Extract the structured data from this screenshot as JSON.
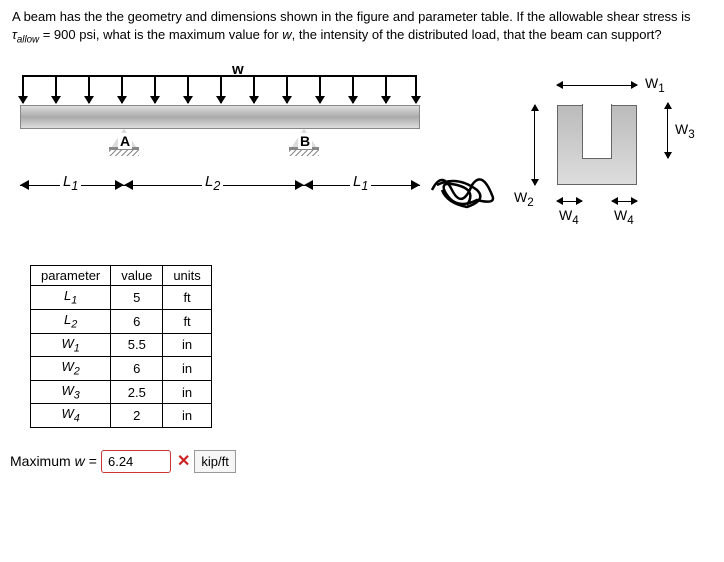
{
  "problem": {
    "text_before_tau": "A beam has the the geometry and dimensions shown in the figure and parameter table. If the allowable shear stress is ",
    "tau_symbol": "τ",
    "tau_sub": "allow",
    "tau_value": " = 900 psi, what is the maximum value for ",
    "w_var": "w",
    "text_after_w": ", the intensity of the distributed load, that the beam can support?"
  },
  "figure": {
    "load_label": "w",
    "support_A": "A",
    "support_B": "B",
    "dim_L1": "L",
    "dim_L1_sub": "1",
    "dim_L2": "L",
    "dim_L2_sub": "2",
    "xsec": {
      "W1": "W",
      "W1_sub": "1",
      "W2": "W",
      "W2_sub": "2",
      "W3": "W",
      "W3_sub": "3",
      "W4": "W",
      "W4_sub": "4"
    }
  },
  "table": {
    "headers": {
      "p": "parameter",
      "v": "value",
      "u": "units"
    },
    "rows": [
      {
        "p": "L",
        "psub": "1",
        "v": "5",
        "u": "ft"
      },
      {
        "p": "L",
        "psub": "2",
        "v": "6",
        "u": "ft"
      },
      {
        "p": "W",
        "psub": "1",
        "v": "5.5",
        "u": "in"
      },
      {
        "p": "W",
        "psub": "2",
        "v": "6",
        "u": "in"
      },
      {
        "p": "W",
        "psub": "3",
        "v": "2.5",
        "u": "in"
      },
      {
        "p": "W",
        "psub": "4",
        "v": "2",
        "u": "in"
      }
    ]
  },
  "answer": {
    "label_prefix": "Maximum ",
    "label_var": "w",
    "label_eq": " = ",
    "value": "6.24",
    "units": "kip/ft",
    "correct": false
  }
}
